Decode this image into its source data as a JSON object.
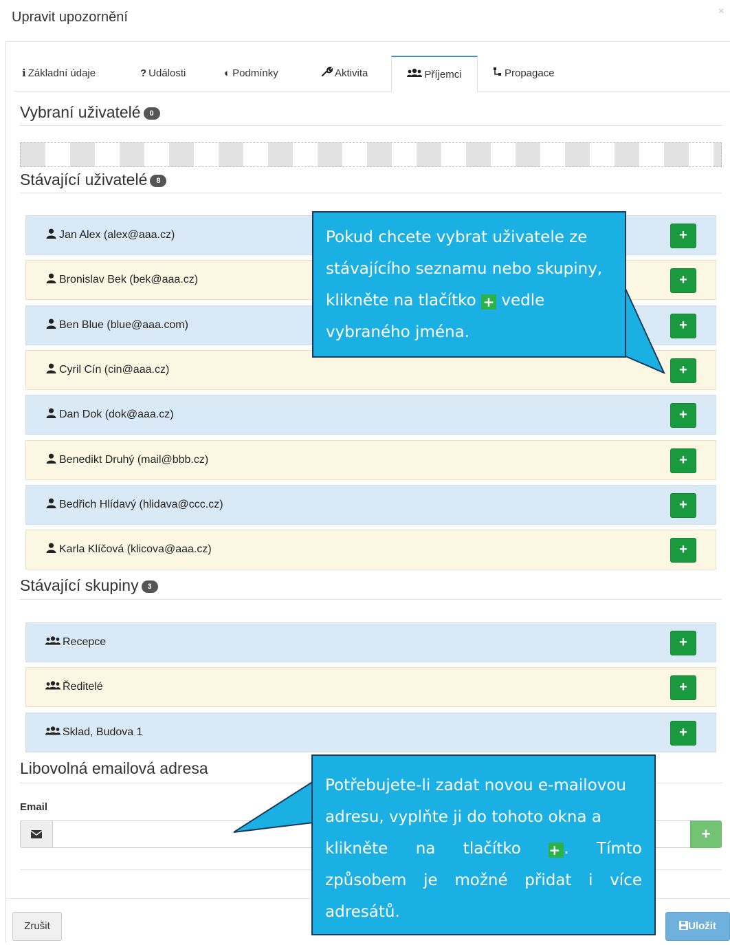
{
  "modal": {
    "title": "Upravit upozornění",
    "close": "×"
  },
  "tabs": [
    {
      "icon": "info-icon",
      "glyph": "i",
      "label": "Základní údaje"
    },
    {
      "icon": "question-icon",
      "glyph": "?",
      "label": "Události"
    },
    {
      "icon": "half-circle-icon",
      "glyph": "◐",
      "label": "Podmínky"
    },
    {
      "icon": "wrench-icon",
      "glyph": "🔧",
      "label": "Aktivita"
    },
    {
      "icon": "users-icon",
      "glyph": "👥",
      "label": "Příjemci"
    },
    {
      "icon": "sitemap-icon",
      "glyph": "⤷",
      "label": "Propagace"
    }
  ],
  "selected_users": {
    "title": "Vybraní uživatelé",
    "count": "0"
  },
  "existing_users": {
    "title": "Stávající uživatelé",
    "count": "8",
    "items": [
      {
        "label": "Jan Alex (alex@aaa.cz)",
        "add": "+"
      },
      {
        "label": "Bronislav Bek (bek@aaa.cz)",
        "add": "+"
      },
      {
        "label": "Ben Blue (blue@aaa.com)",
        "add": "+"
      },
      {
        "label": "Cyril Cín (cin@aaa.cz)",
        "add": "+"
      },
      {
        "label": "Dan Dok (dok@aaa.cz)",
        "add": "+"
      },
      {
        "label": "Benedikt Druhý (mail@bbb.cz)",
        "add": "+"
      },
      {
        "label": "Bedřich Hlídavý (hlidava@ccc.cz)",
        "add": "+"
      },
      {
        "label": "Karla Klíčová (klicova@aaa.cz)",
        "add": "+"
      }
    ]
  },
  "existing_groups": {
    "title": "Stávající skupiny",
    "count": "3",
    "items": [
      {
        "label": "Recepce",
        "add": "+"
      },
      {
        "label": "Ředitelé",
        "add": "+"
      },
      {
        "label": "Sklad, Budova 1",
        "add": "+"
      }
    ]
  },
  "email_section": {
    "title": "Libovolná emailová adresa",
    "label": "Email",
    "value": "",
    "add": "+"
  },
  "footer": {
    "cancel": "Zrušit",
    "save": "Uložit"
  },
  "callouts": {
    "one": {
      "line1": "Pokud chcete vybrat uživatele ze",
      "line2": "stávajícího seznamu nebo skupiny,",
      "line3a": "klikněte na tlačítko",
      "line3b": "vedle",
      "line4": "vybraného jména."
    },
    "two": {
      "line1": "Potřebujete-li zadat novou e-mailovou",
      "line2": "adresu, vyplňte ji do tohoto okna a",
      "line3a": "klikněte na tlačítko",
      "line3b": ". Tímto",
      "line4": "způsobem je možné přidat i více",
      "line5": "adresátů."
    }
  },
  "colors": {
    "row_blue": "#d9e9f5",
    "row_cream": "#fcf7e3",
    "add_green": "#1a9a3e",
    "callout_bg": "#1ab0e3",
    "save_blue": "#6fb0dc"
  }
}
